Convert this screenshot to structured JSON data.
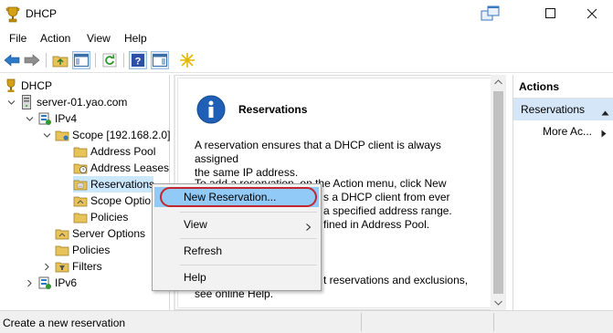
{
  "window": {
    "title": "DHCP"
  },
  "menubar": {
    "items": [
      "File",
      "Action",
      "View",
      "Help"
    ]
  },
  "tree": {
    "root": "DHCP",
    "server": "server-01.yao.com",
    "ipv4": "IPv4",
    "scope": "Scope [192.168.2.0]",
    "address_pool": "Address Pool",
    "address_leases": "Address Leases",
    "reservations": "Reservations",
    "scope_options": "Scope Optio",
    "policies_scope": "Policies",
    "server_options": "Server Options",
    "policies": "Policies",
    "filters": "Filters",
    "ipv6": "IPv6"
  },
  "content": {
    "heading": "Reservations",
    "para1_line1": "A reservation ensures that a DHCP client is always assigned",
    "para1_line2": "the same IP address.",
    "para2_line1": "To add a reservation, on the Action menu, click New",
    "para2_line2": "s a DHCP client from ever",
    "para2_line3": "a specified address range.",
    "para2_line4": "fined in Address Pool.",
    "para3_line1": "t reservations and exclusions,",
    "para3_line2": "see online Help."
  },
  "actions": {
    "title": "Actions",
    "section": "Reservations",
    "more": "More Ac..."
  },
  "context_menu": {
    "new_reservation": "New Reservation...",
    "view": "View",
    "refresh": "Refresh",
    "help": "Help"
  },
  "status": {
    "text": "Create a new reservation"
  },
  "colors": {
    "selection": "#cce8ff",
    "menu_highlight": "#91c9f7",
    "annotation_ring": "#c1272d",
    "actions_section": "#d4e6f7"
  }
}
